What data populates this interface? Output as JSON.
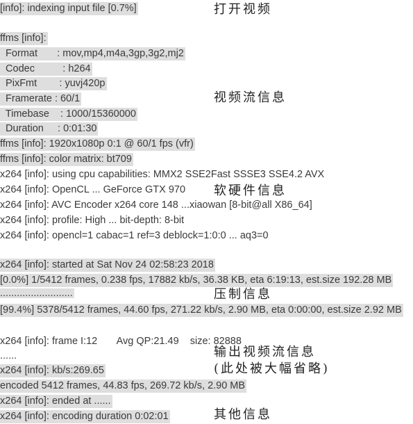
{
  "log": [
    {
      "text": "[info]: indexing input file [0.7%]",
      "hl": true
    },
    {
      "text": "ffms [info]:",
      "hl": true
    },
    {
      "text": "  Format       : mov,mp4,m4a,3gp,3g2,mj2",
      "hl": true
    },
    {
      "text": "  Codec          : h264",
      "hl": true
    },
    {
      "text": "  PixFmt        : yuvj420p",
      "hl": true
    },
    {
      "text": "  Framerate : 60/1",
      "hl": true
    },
    {
      "text": "  Timebase    : 1000/15360000",
      "hl": true
    },
    {
      "text": "  Duration     : 0:01:30",
      "hl": true
    },
    {
      "text": "ffms [info]: 1920x1080p 0:1 @ 60/1 fps (vfr)",
      "hl": true
    },
    {
      "text": "ffms [info]: color matrix: bt709",
      "hl": true
    },
    {
      "text": "x264 [info]: using cpu capabilities: MMX2 SSE2Fast SSSE3 SSE4.2 AVX",
      "hl": false
    },
    {
      "text": "x264 [info]: OpenCL ... GeForce GTX 970",
      "hl": false
    },
    {
      "text": "x264 [info]: AVC Encoder x264 core 148 ...xiaowan [8-bit@all X86_64]",
      "hl": false
    },
    {
      "text": "x264 [info]: profile: High ... bit-depth: 8-bit",
      "hl": false
    },
    {
      "text": "x264 [info]: opencl=1 cabac=1 ref=3 deblock=1:0:0 ... aq3=0",
      "hl": false
    },
    {
      "text": "x264 [info]: started at Sat Nov 24 02:58:23 2018",
      "hl": true
    },
    {
      "text": "[0.0%] 1/5412 frames, 0.238 fps, 17882 kb/s, 36.38 KB, eta 6:19:13, est.size 192.28 MB",
      "hl": true
    },
    {
      "text": "..........................",
      "hl": true
    },
    {
      "text": "[99.4%] 5378/5412 frames, 44.60 fps, 271.22 kb/s, 2.90 MB, eta 0:00:00, est.size 2.92 MB",
      "hl": true
    },
    {
      "text": "x264 [info]: frame I:12       Avg QP:21.49    size: 82888",
      "hl": false
    },
    {
      "text": "......",
      "hl": false
    },
    {
      "text": "x264 [info]: kb/s:269.65",
      "hl": true
    },
    {
      "text": "encoded 5412 frames, 44.83 fps, 269.72 kb/s, 2.90 MB",
      "hl": true
    },
    {
      "text": "x264 [info]: ended at ......",
      "hl": true
    },
    {
      "text": "x264 [info]: encoding duration 0:02:01",
      "hl": true
    }
  ],
  "annotations": [
    "打开视频",
    "视频流信息",
    "软硬件信息",
    "压制信息",
    "输出视频流信息",
    "(此处被大幅省略)",
    "其他信息"
  ]
}
